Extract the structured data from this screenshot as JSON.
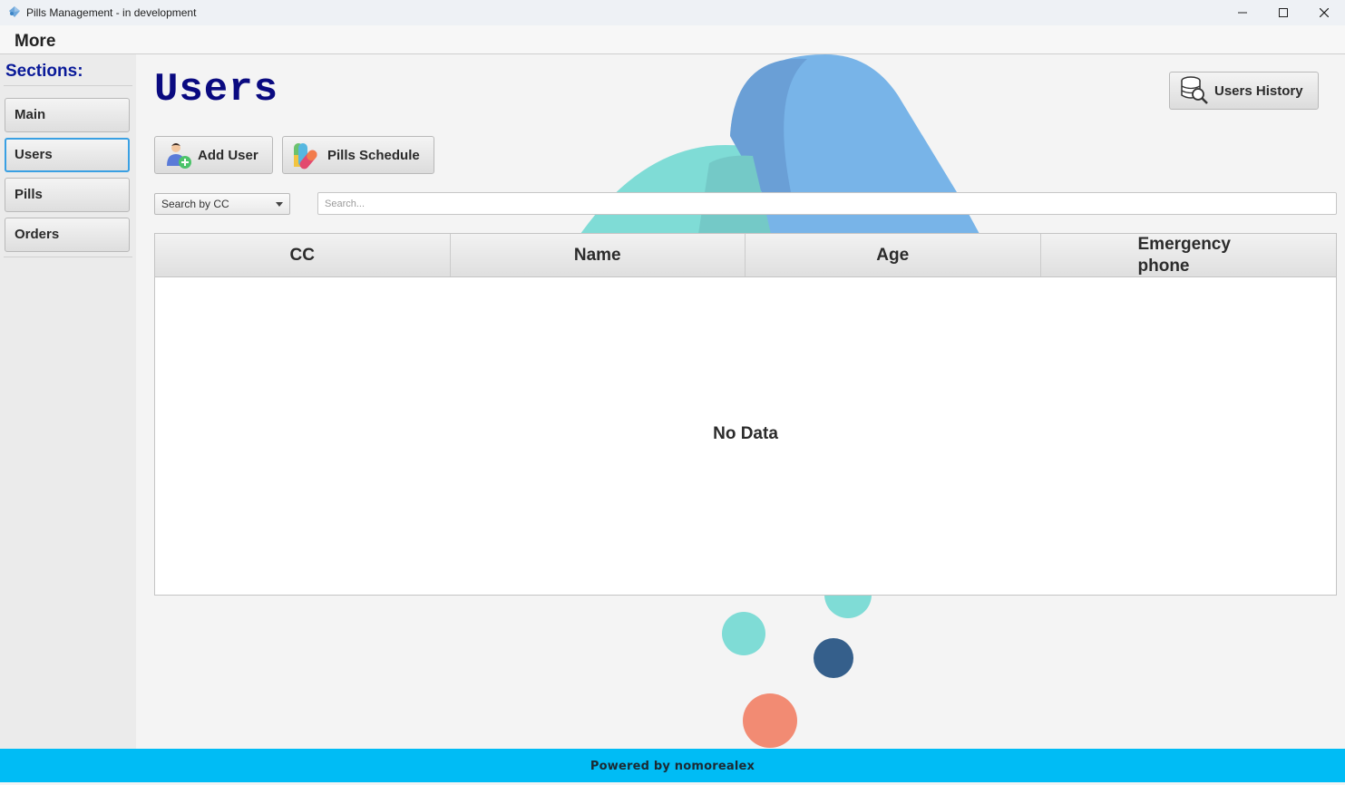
{
  "window": {
    "title": "Pills Management - in development"
  },
  "menu": {
    "more_label": "More"
  },
  "sidebar": {
    "title": "Sections:",
    "items": [
      {
        "label": "Main",
        "active": false
      },
      {
        "label": "Users",
        "active": true
      },
      {
        "label": "Pills",
        "active": false
      },
      {
        "label": "Orders",
        "active": false
      }
    ]
  },
  "main": {
    "page_title": "Users",
    "users_history_label": "Users History",
    "add_user_label": "Add User",
    "pills_schedule_label": "Pills Schedule",
    "search_by": {
      "selected": "Search by CC"
    },
    "search": {
      "placeholder": "Search...",
      "value": ""
    },
    "table": {
      "columns": [
        "CC",
        "Name",
        "Age",
        "Emergency phone"
      ],
      "rows": [],
      "empty_text": "No Data"
    }
  },
  "footer": {
    "text": "Powered by nomorealex"
  },
  "colors": {
    "accent_title": "#0a0a80",
    "footer_bg": "#00bcf5",
    "active_border": "#39a0e3"
  }
}
